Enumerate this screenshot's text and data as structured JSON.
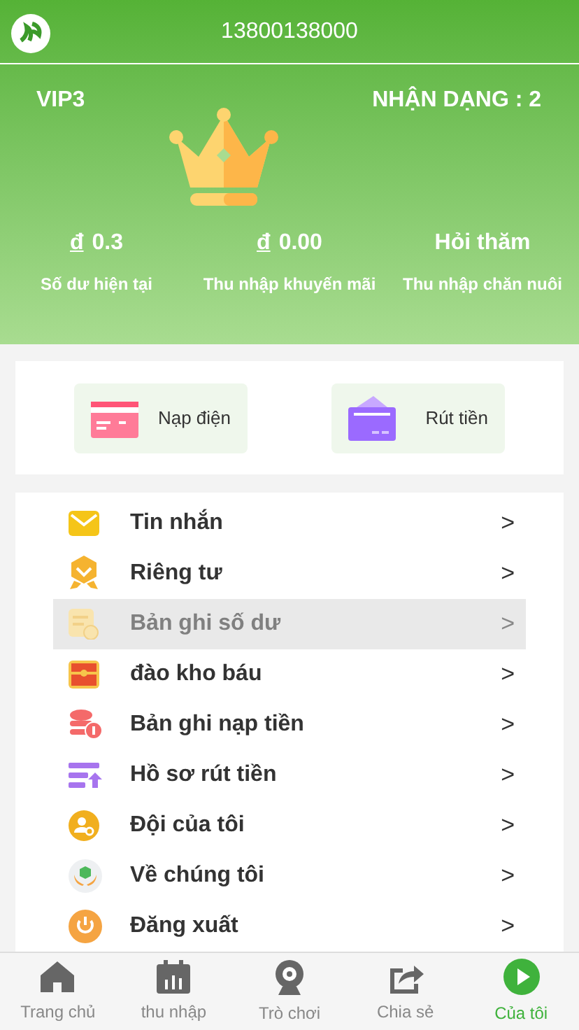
{
  "header": {
    "title": "13800138000"
  },
  "profile": {
    "vip": "VIP3",
    "id_label": "NHẬN DẠNG : 2"
  },
  "stats": [
    {
      "value": "0.3",
      "currency": "đ",
      "label": "Số dư hiện tại"
    },
    {
      "value": "0.00",
      "currency": "đ",
      "label": "Thu nhập khuyến mãi"
    },
    {
      "value": "Hỏi thăm",
      "label": "Thu nhập chăn nuôi"
    }
  ],
  "actions": [
    {
      "kind": "deposit",
      "label": "Nạp điện"
    },
    {
      "kind": "withdraw",
      "label": "Rút tiền"
    }
  ],
  "menu": [
    {
      "kind": "mail",
      "label": "Tin nhắn",
      "arrow": ">",
      "selected": false
    },
    {
      "kind": "badge",
      "label": "Riêng tư",
      "arrow": ">",
      "selected": false
    },
    {
      "kind": "ledger",
      "label": "Bản ghi số dư",
      "arrow": ">",
      "selected": true
    },
    {
      "kind": "chest",
      "label": "đào kho báu",
      "arrow": ">",
      "selected": false
    },
    {
      "kind": "coins",
      "label": "Bản ghi nạp tiền",
      "arrow": ">",
      "selected": false
    },
    {
      "kind": "upload",
      "label": "Hồ sơ rút tiền",
      "arrow": ">",
      "selected": false
    },
    {
      "kind": "team",
      "label": "Đội của tôi",
      "arrow": ">",
      "selected": false
    },
    {
      "kind": "about",
      "label": "Về chúng tôi",
      "arrow": ">",
      "selected": false
    },
    {
      "kind": "logout",
      "label": "Đăng xuất",
      "arrow": ">",
      "selected": false
    }
  ],
  "tabbar": [
    {
      "kind": "home",
      "label": "Trang chủ",
      "selected": false
    },
    {
      "kind": "income",
      "label": "thu nhập",
      "selected": false
    },
    {
      "kind": "game",
      "label": "Trò chơi",
      "selected": false
    },
    {
      "kind": "share",
      "label": "Chia sẻ",
      "selected": false
    },
    {
      "kind": "me",
      "label": "Của tôi",
      "selected": true
    }
  ]
}
